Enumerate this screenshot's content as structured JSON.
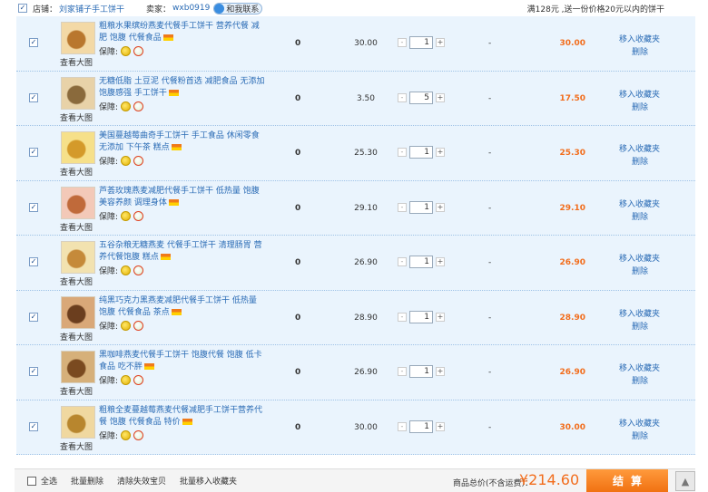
{
  "store": {
    "checked": true,
    "store_label": "店铺：",
    "store_name": "刘家铺子手工饼干",
    "seller_label": "卖家：",
    "seller_name": "wxb0919",
    "contact_label": "和我联系",
    "promo": "满128元 ,送一份价格20元以内的饼干"
  },
  "common": {
    "view_big": "查看大图",
    "guarantee_label": "保障:",
    "zero": "0",
    "minus": "-",
    "plus": "+",
    "discount": "-",
    "add_fav": "移入收藏夹",
    "delete": "删除"
  },
  "items": [
    {
      "title": "粗粮水果缤纷燕麦代餐手工饼干 营养代餐 减肥 饱腹 代餐食品",
      "price": "30.00",
      "qty": "1",
      "subtotal": "30.00",
      "checked": true
    },
    {
      "title": "无糖低脂 土豆泥 代餐粉首选 减肥食品 无添加 饱腹感强 手工饼干",
      "price": "3.50",
      "qty": "5",
      "subtotal": "17.50",
      "checked": true
    },
    {
      "title": "美国蔓越莓曲奇手工饼干 手工食品 休闲零食 无添加 下午茶 糕点",
      "price": "25.30",
      "qty": "1",
      "subtotal": "25.30",
      "checked": true
    },
    {
      "title": "芦荟玫瑰燕麦减肥代餐手工饼干 低热量 饱腹 美容养颜 调理身体",
      "price": "29.10",
      "qty": "1",
      "subtotal": "29.10",
      "checked": true
    },
    {
      "title": "五谷杂粮无糖燕麦 代餐手工饼干 清理肠胃 营养代餐饱腹 糕点",
      "price": "26.90",
      "qty": "1",
      "subtotal": "26.90",
      "checked": true
    },
    {
      "title": "纯黑巧克力黑燕麦减肥代餐手工饼干 低热量 饱腹 代餐食品 茶点",
      "price": "28.90",
      "qty": "1",
      "subtotal": "28.90",
      "checked": true
    },
    {
      "title": "黑咖啡燕麦代餐手工饼干 饱腹代餐 饱腹 低卡食品 吃不胖",
      "price": "26.90",
      "qty": "1",
      "subtotal": "26.90",
      "checked": true
    },
    {
      "title": "粗粮全麦蔓越莓燕麦代餐减肥手工饼干营养代餐 饱腹 代餐食品 特价",
      "price": "30.00",
      "qty": "1",
      "subtotal": "30.00",
      "checked": true
    }
  ],
  "footer": {
    "select_all": "全选",
    "batch_delete": "批量删除",
    "clear_invalid": "清除失效宝贝",
    "batch_fav": "批量移入收藏夹",
    "total_label": "商品总价(不含运费)：",
    "total_amount": "¥214.60",
    "checkout": "结算",
    "back_top_icon": "arrow-up-icon"
  },
  "colors": {
    "row_bg": "#eaf4fd",
    "link": "#2a6bb5",
    "price_accent": "#f26d1c",
    "checkout_bg": "#f07010"
  }
}
